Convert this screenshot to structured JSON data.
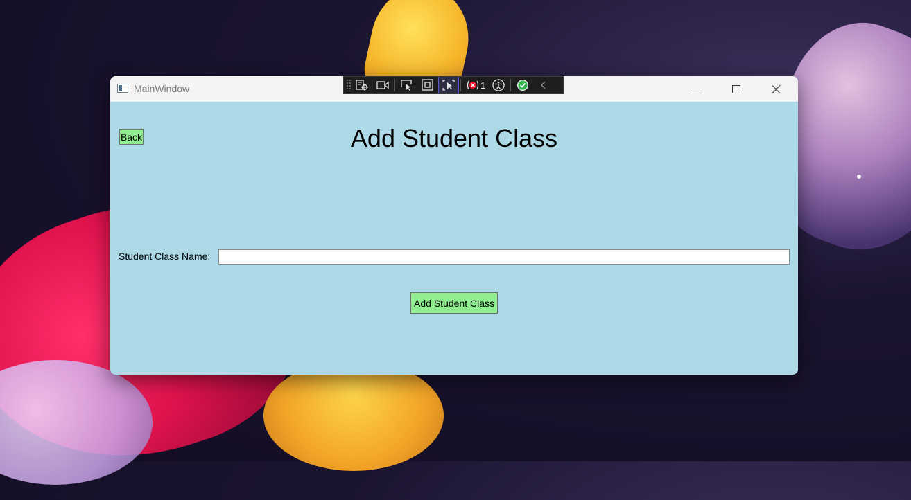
{
  "window": {
    "title": "MainWindow",
    "caption_buttons": {
      "minimize": "minimize-icon",
      "maximize": "maximize-icon",
      "close": "close-icon"
    }
  },
  "devbar": {
    "tools": [
      "live-visual-tree-icon",
      "select-element-icon",
      "video-icon",
      "hot-reload-select-icon",
      "display-layout-adorners-icon",
      "track-focus-icon",
      "binding-failures-icon",
      "accessibility-icon",
      "checkmark-icon",
      "collapse-chevron-icon"
    ],
    "binding_failures_count": "1"
  },
  "page": {
    "back_label": "Back",
    "title": "Add Student Class",
    "field_label": "Student Class Name:",
    "field_value": "",
    "submit_label": "Add Student Class"
  },
  "colors": {
    "content_background": "#add8e6",
    "button_background": "#90ee90",
    "titlebar": "#f3f3f3"
  }
}
